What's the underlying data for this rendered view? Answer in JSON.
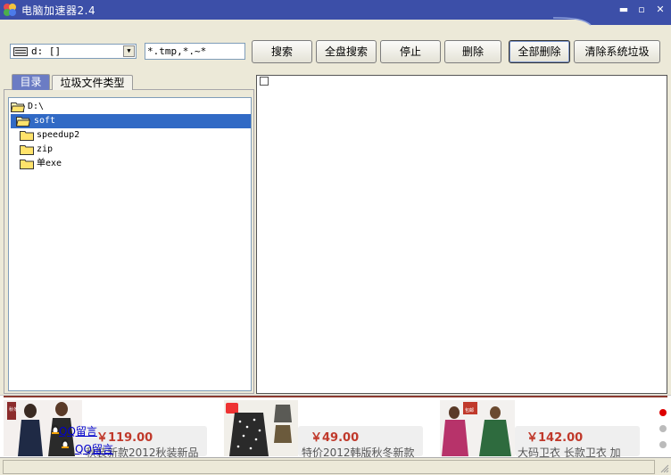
{
  "window": {
    "title": "电脑加速器2.4",
    "accent": "#3c4fa8"
  },
  "toolbar": {
    "drive_value": "d: []",
    "pattern_value": "*.tmp,*.~*",
    "buttons": {
      "search": "搜索",
      "full_search": "全盘搜索",
      "stop": "停止",
      "delete": "删除",
      "delete_all": "全部删除",
      "clean_system": "清除系统垃圾"
    }
  },
  "tabs": {
    "directory": "目录",
    "junk_types": "垃圾文件类型"
  },
  "tree": {
    "root": "D:\\",
    "items": [
      {
        "label": "soft",
        "selected": true
      },
      {
        "label": "speedup2",
        "selected": false
      },
      {
        "label": "zip",
        "selected": false
      },
      {
        "label": "单exe",
        "selected": false
      }
    ]
  },
  "ads": {
    "items": [
      {
        "price": "￥119.00",
        "desc": "秋装新款2012秋装新品"
      },
      {
        "price": "￥49.00",
        "desc": "特价2012韩版秋冬新款"
      },
      {
        "price": "￥142.00",
        "desc": "大码卫衣 长款卫衣 加"
      }
    ],
    "qq_links": [
      "QQ留言",
      "QQ留言"
    ],
    "badges": [
      "秋冬",
      "包邮"
    ],
    "active_color": "#dd0000"
  },
  "status": {
    "text": ""
  }
}
